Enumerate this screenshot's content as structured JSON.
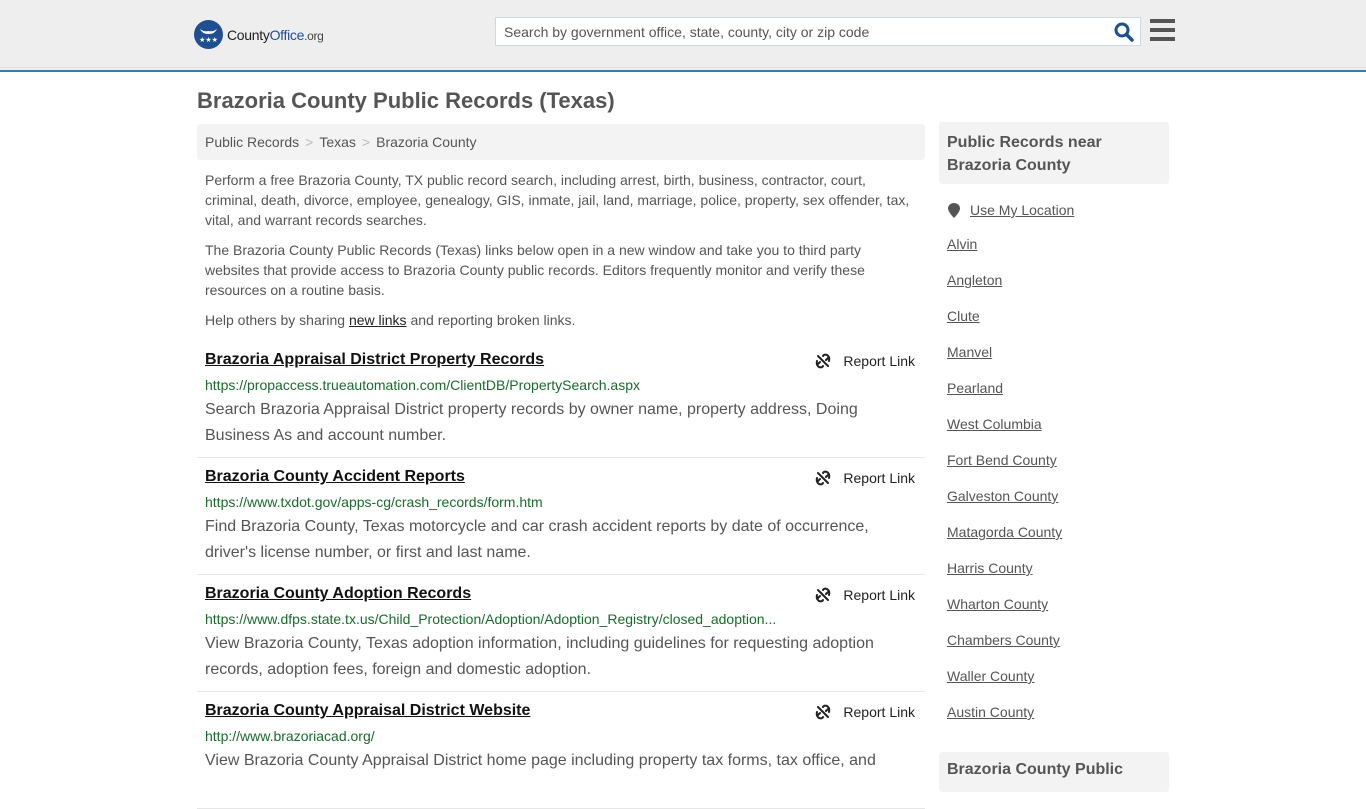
{
  "header": {
    "logo": {
      "county": "County",
      "office": "Office",
      "org": ".org"
    },
    "search_placeholder": "Search by government office, state, county, city or zip code",
    "colors": {
      "brand": "#1d4f91",
      "header_border": "#3a7cac"
    }
  },
  "page_title": "Brazoria County Public Records (Texas)",
  "breadcrumb": [
    {
      "label": "Public Records"
    },
    {
      "label": "Texas"
    },
    {
      "label": "Brazoria County"
    }
  ],
  "breadcrumb_separator": ">",
  "intro": {
    "p1": "Perform a free Brazoria County, TX public record search, including arrest, birth, business, contractor, court, criminal, death, divorce, employee, genealogy, GIS, inmate, jail, land, marriage, police, property, sex offender, tax, vital, and warrant records searches.",
    "p2": "The Brazoria County Public Records (Texas) links below open in a new window and take you to third party websites that provide access to Brazoria County public records. Editors frequently monitor and verify these resources on a routine basis.",
    "p3_before": "Help others by sharing ",
    "p3_link": "new links",
    "p3_after": " and reporting broken links."
  },
  "report_label": "Report Link",
  "records": [
    {
      "title": "Brazoria Appraisal District Property Records",
      "url": "https://propaccess.trueautomation.com/ClientDB/PropertySearch.aspx",
      "description": "Search Brazoria Appraisal District property records by owner name, property address, Doing Business As and account number."
    },
    {
      "title": "Brazoria County Accident Reports",
      "url": "https://www.txdot.gov/apps-cg/crash_records/form.htm",
      "description": "Find Brazoria County, Texas motorcycle and car crash accident reports by date of occurrence, driver's license number, or first and last name."
    },
    {
      "title": "Brazoria County Adoption Records",
      "url": "https://www.dfps.state.tx.us/Child_Protection/Adoption/Adoption_Registry/closed_adoption...",
      "description": "View Brazoria County, Texas adoption information, including guidelines for requesting adoption records, adoption fees, foreign and domestic adoption."
    },
    {
      "title": "Brazoria County Appraisal District Website",
      "url": "http://www.brazoriacad.org/",
      "description": "View Brazoria County Appraisal District home page including property tax forms, tax office, and"
    }
  ],
  "sidebar": {
    "heading": "Public Records near Brazoria County",
    "use_location": "Use My Location",
    "places": [
      "Alvin",
      "Angleton",
      "Clute",
      "Manvel",
      "Pearland",
      "West Columbia",
      "Fort Bend County",
      "Galveston County",
      "Matagorda County",
      "Harris County",
      "Wharton County",
      "Chambers County",
      "Waller County",
      "Austin County"
    ],
    "heading2": "Brazoria County Public"
  }
}
